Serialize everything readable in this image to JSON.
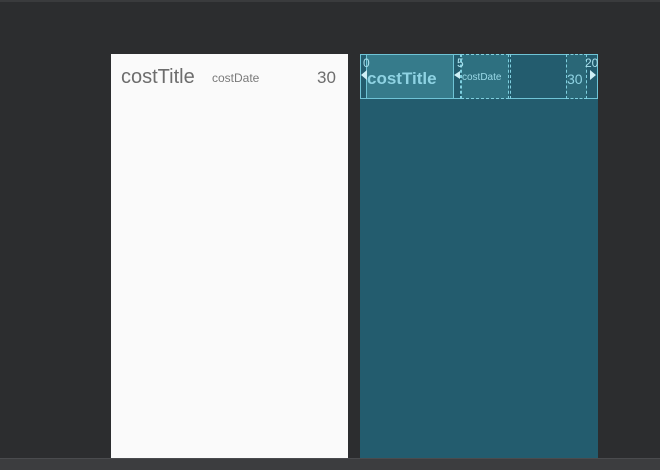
{
  "design_preview": {
    "title_text": "costTitle",
    "date_text": "costDate",
    "amount_text": "30"
  },
  "blueprint_preview": {
    "title_text": "costTitle",
    "date_text": "costDate",
    "amount_text": "30",
    "margins": {
      "left_label": "0",
      "middle_label": "5",
      "right_label": "20"
    }
  },
  "colors": {
    "workspace_background": "#2c2d2f",
    "design_surface": "#fafafa",
    "blueprint_surface": "#235c6e",
    "blueprint_accent": "#6fc4d6"
  }
}
